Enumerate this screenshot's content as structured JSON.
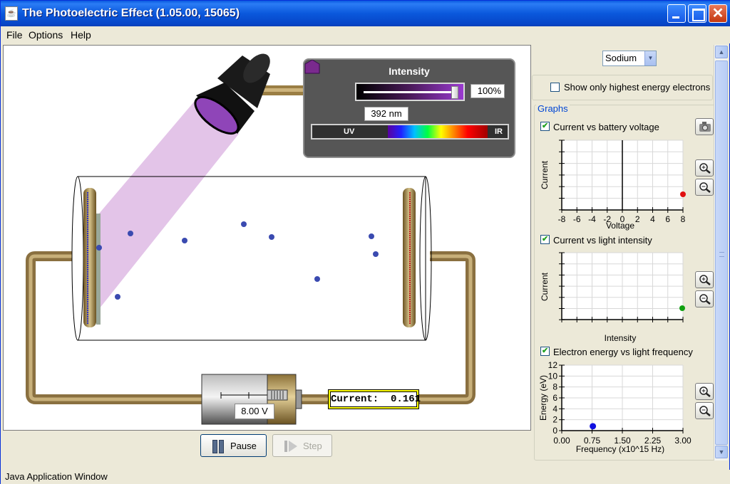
{
  "window": {
    "title": "The Photoelectric Effect (1.05.00, 15065)"
  },
  "menu": {
    "file": "File",
    "options": "Options",
    "help": "Help"
  },
  "intensity": {
    "label": "Intensity",
    "value": "100%",
    "level": 1.0
  },
  "wavelength": {
    "value": "392 nm",
    "uv_label": "UV",
    "ir_label": "IR"
  },
  "battery": {
    "voltage": "8.00 V"
  },
  "current": {
    "label": "Current:",
    "value": "0.161"
  },
  "sim_controls": {
    "pause_label": "Pause",
    "step_label": "Step"
  },
  "controls": {
    "target_value": "Sodium",
    "show_only_label": "Show only highest energy electrons",
    "show_only_checked": false,
    "graphs_title": "Graphs",
    "graph1": {
      "label": "Current vs battery voltage",
      "checked": true,
      "xlabel": "Voltage",
      "ylabel": "Current",
      "xticks": [
        "-8",
        "-6",
        "-4",
        "-2",
        "0",
        "2",
        "4",
        "6",
        "8"
      ],
      "point": {
        "x": 8,
        "y": 0
      },
      "point_color": "#e01010"
    },
    "graph2": {
      "label": "Current vs light intensity",
      "checked": true,
      "xlabel": "Intensity",
      "ylabel": "Current",
      "point_color": "#10a010"
    },
    "graph3": {
      "label": "Electron energy vs light frequency",
      "checked": true,
      "xlabel": "Frequency (x10^15 Hz)",
      "ylabel": "Energy (eV)",
      "xticks": [
        "0.00",
        "0.75",
        "1.50",
        "2.25",
        "3.00"
      ],
      "yticks": [
        "0",
        "2",
        "4",
        "6",
        "8",
        "10",
        "12"
      ],
      "point": {
        "x": 0.77,
        "y": 0.8
      },
      "point_color": "#1010e0"
    }
  },
  "icons": {
    "camera": "camera-icon",
    "zoom_in": "zoom-in-icon",
    "zoom_out": "zoom-out-icon"
  },
  "status": {
    "text": "Java Application Window"
  },
  "colors": {
    "title_bar": "#0a58dc",
    "light_beam": "#d9b0e0",
    "photon": "#3a4ab0",
    "wire": "#8a7040"
  }
}
